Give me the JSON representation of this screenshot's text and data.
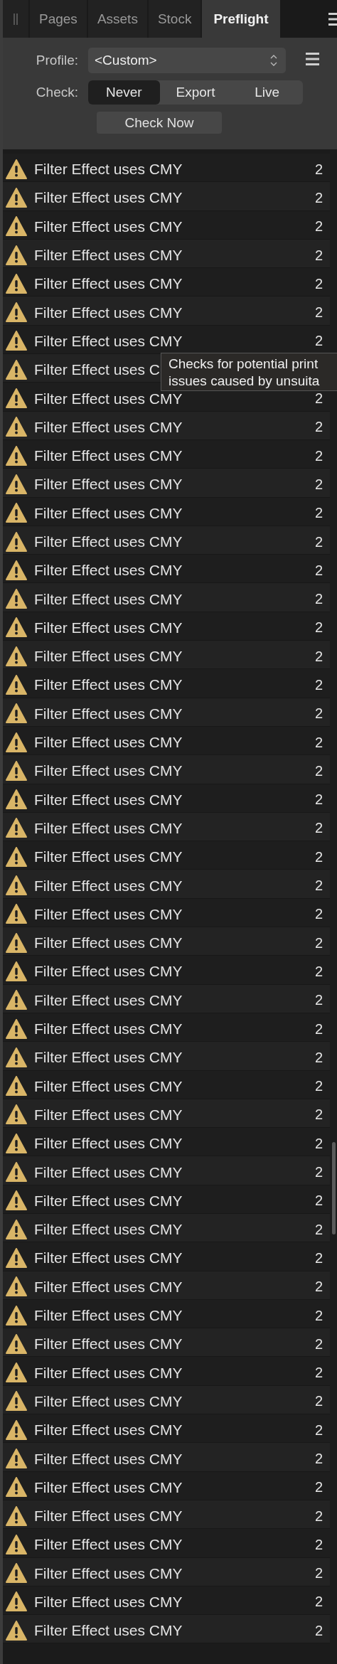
{
  "tabs": [
    {
      "label": "Pages",
      "selected": false
    },
    {
      "label": "Assets",
      "selected": false
    },
    {
      "label": "Stock",
      "selected": false
    },
    {
      "label": "Preflight",
      "selected": true
    }
  ],
  "profile": {
    "label": "Profile:",
    "value": "<Custom>"
  },
  "check": {
    "label": "Check:",
    "options": [
      {
        "label": "Never",
        "selected": true
      },
      {
        "label": "Export",
        "selected": false
      },
      {
        "label": "Live",
        "selected": false
      }
    ]
  },
  "check_now": "Check Now",
  "issues": [
    {
      "text": "Filter Effect uses CMY",
      "count": "2"
    },
    {
      "text": "Filter Effect uses CMY",
      "count": "2"
    },
    {
      "text": "Filter Effect uses CMY",
      "count": "2"
    },
    {
      "text": "Filter Effect uses CMY",
      "count": "2"
    },
    {
      "text": "Filter Effect uses CMY",
      "count": "2"
    },
    {
      "text": "Filter Effect uses CMY",
      "count": "2"
    },
    {
      "text": "Filter Effect uses CMY",
      "count": "2"
    },
    {
      "text": "Filter Effect uses C"
    },
    {
      "text": "Filter Effect uses CMY",
      "count": "2"
    },
    {
      "text": "Filter Effect uses CMY",
      "count": "2"
    },
    {
      "text": "Filter Effect uses CMY",
      "count": "2"
    },
    {
      "text": "Filter Effect uses CMY",
      "count": "2"
    },
    {
      "text": "Filter Effect uses CMY",
      "count": "2"
    },
    {
      "text": "Filter Effect uses CMY",
      "count": "2"
    },
    {
      "text": "Filter Effect uses CMY",
      "count": "2"
    },
    {
      "text": "Filter Effect uses CMY",
      "count": "2"
    },
    {
      "text": "Filter Effect uses CMY",
      "count": "2"
    },
    {
      "text": "Filter Effect uses CMY",
      "count": "2"
    },
    {
      "text": "Filter Effect uses CMY",
      "count": "2"
    },
    {
      "text": "Filter Effect uses CMY",
      "count": "2"
    },
    {
      "text": "Filter Effect uses CMY",
      "count": "2"
    },
    {
      "text": "Filter Effect uses CMY",
      "count": "2"
    },
    {
      "text": "Filter Effect uses CMY",
      "count": "2"
    },
    {
      "text": "Filter Effect uses CMY",
      "count": "2"
    },
    {
      "text": "Filter Effect uses CMY",
      "count": "2"
    },
    {
      "text": "Filter Effect uses CMY",
      "count": "2"
    },
    {
      "text": "Filter Effect uses CMY",
      "count": "2"
    },
    {
      "text": "Filter Effect uses CMY",
      "count": "2"
    },
    {
      "text": "Filter Effect uses CMY",
      "count": "2"
    },
    {
      "text": "Filter Effect uses CMY",
      "count": "2"
    },
    {
      "text": "Filter Effect uses CMY",
      "count": "2"
    },
    {
      "text": "Filter Effect uses CMY",
      "count": "2"
    },
    {
      "text": "Filter Effect uses CMY",
      "count": "2"
    },
    {
      "text": "Filter Effect uses CMY",
      "count": "2"
    },
    {
      "text": "Filter Effect uses CMY",
      "count": "2"
    },
    {
      "text": "Filter Effect uses CMY",
      "count": "2"
    },
    {
      "text": "Filter Effect uses CMY",
      "count": "2"
    },
    {
      "text": "Filter Effect uses CMY",
      "count": "2"
    },
    {
      "text": "Filter Effect uses CMY",
      "count": "2"
    },
    {
      "text": "Filter Effect uses CMY",
      "count": "2"
    },
    {
      "text": "Filter Effect uses CMY",
      "count": "2"
    },
    {
      "text": "Filter Effect uses CMY",
      "count": "2"
    },
    {
      "text": "Filter Effect uses CMY",
      "count": "2"
    },
    {
      "text": "Filter Effect uses CMY",
      "count": "2"
    },
    {
      "text": "Filter Effect uses CMY",
      "count": "2"
    },
    {
      "text": "Filter Effect uses CMY",
      "count": "2"
    },
    {
      "text": "Filter Effect uses CMY",
      "count": "2"
    },
    {
      "text": "Filter Effect uses CMY",
      "count": "2"
    },
    {
      "text": "Filter Effect uses CMY",
      "count": "2"
    },
    {
      "text": "Filter Effect uses CMY",
      "count": "2"
    },
    {
      "text": "Filter Effect uses CMY",
      "count": "2"
    },
    {
      "text": "Filter Effect uses CMY",
      "count": "2"
    }
  ],
  "tooltip": {
    "lines": [
      "Checks for potential print",
      "issues caused by unsuita"
    ]
  }
}
